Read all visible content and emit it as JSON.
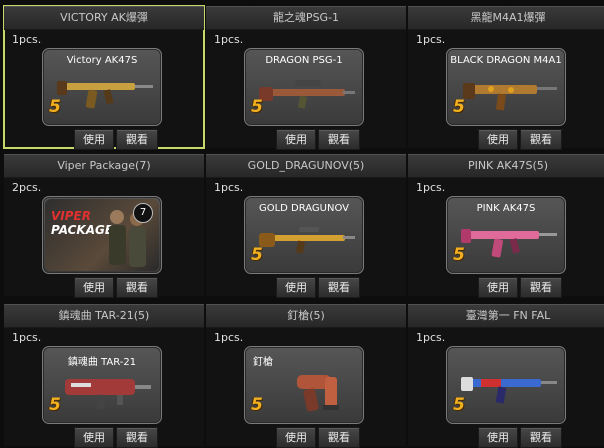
{
  "buttons": {
    "use_label": "使用",
    "view_label": "觀看"
  },
  "items": [
    {
      "title": "VICTORY AK爆彈",
      "count": "1pcs.",
      "card_name": "Victory AK47S",
      "grade": "5",
      "gun_color": "#c9a040",
      "selected": true
    },
    {
      "title": "龍之魂PSG-1",
      "count": "1pcs.",
      "card_name": "DRAGON PSG-1",
      "grade": "5",
      "gun_color": "#9a5a3a"
    },
    {
      "title": "黑龍M4A1爆彈",
      "count": "1pcs.",
      "card_name": "BLACK DRAGON M4A1",
      "grade": "5",
      "gun_color": "#b07a30"
    },
    {
      "title": "Viper Package(7)",
      "count": "2pcs.",
      "card_name": "",
      "grade": "",
      "package": {
        "line1": "VIPER",
        "line2": "PACKAGE",
        "badge": "7"
      }
    },
    {
      "title": "GOLD_DRAGUNOV(5)",
      "count": "1pcs.",
      "card_name": "GOLD DRAGUNOV",
      "grade": "5",
      "gun_color": "#d4a030"
    },
    {
      "title": "PINK AK47S(5)",
      "count": "1pcs.",
      "card_name": "PINK  AK47S",
      "grade": "5",
      "gun_color": "#e06a9a"
    },
    {
      "title": "鎮魂曲 TAR-21(5)",
      "count": "1pcs.",
      "card_name": "鎮魂曲 TAR-21",
      "grade": "5",
      "gun_color": "#a33a3a"
    },
    {
      "title": "釘槍(5)",
      "count": "1pcs.",
      "card_name": "釘槍",
      "grade": "5",
      "gun_color": "#b0553a"
    },
    {
      "title": "臺灣第一 FN FAL",
      "count": "1pcs.",
      "card_name": "",
      "grade": "5",
      "gun_color": "#3a6ad0"
    }
  ]
}
